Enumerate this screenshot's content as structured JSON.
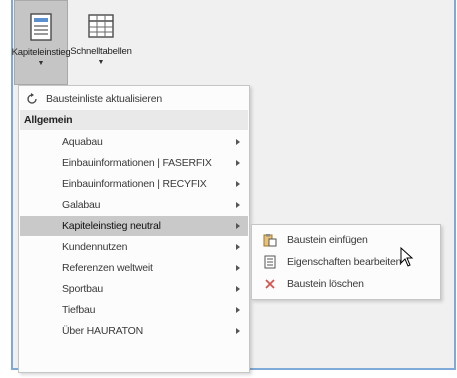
{
  "ribbon": {
    "buttons": [
      {
        "label": "Kapiteleinstieg",
        "icon": "document-list-icon",
        "active": true
      },
      {
        "label": "Schnelltabellen",
        "icon": "table-grid-icon",
        "active": false
      }
    ]
  },
  "menu": {
    "refresh_label": "Bausteinliste aktualisieren",
    "group_header": "Allgemein",
    "items": [
      {
        "label": "Aquabau"
      },
      {
        "label": "Einbauinformationen | FASERFIX"
      },
      {
        "label": "Einbauinformationen | RECYFIX"
      },
      {
        "label": "Galabau"
      },
      {
        "label": "Kapiteleinstieg neutral",
        "selected": true
      },
      {
        "label": "Kundennutzen"
      },
      {
        "label": "Referenzen weltweit"
      },
      {
        "label": "Sportbau"
      },
      {
        "label": "Tiefbau"
      },
      {
        "label": "Über HAURATON"
      }
    ]
  },
  "submenu": {
    "items": [
      {
        "label": "Baustein einfügen",
        "icon": "paste-icon"
      },
      {
        "label": "Eigenschaften bearbeiten",
        "icon": "properties-icon"
      },
      {
        "label": "Baustein löschen",
        "icon": "delete-x-icon"
      }
    ]
  },
  "colors": {
    "frame_border": "#7fa9d6",
    "selected_row": "#c9c9c9",
    "delete_red": "#d9534f",
    "paste_orange": "#d9a23a"
  }
}
